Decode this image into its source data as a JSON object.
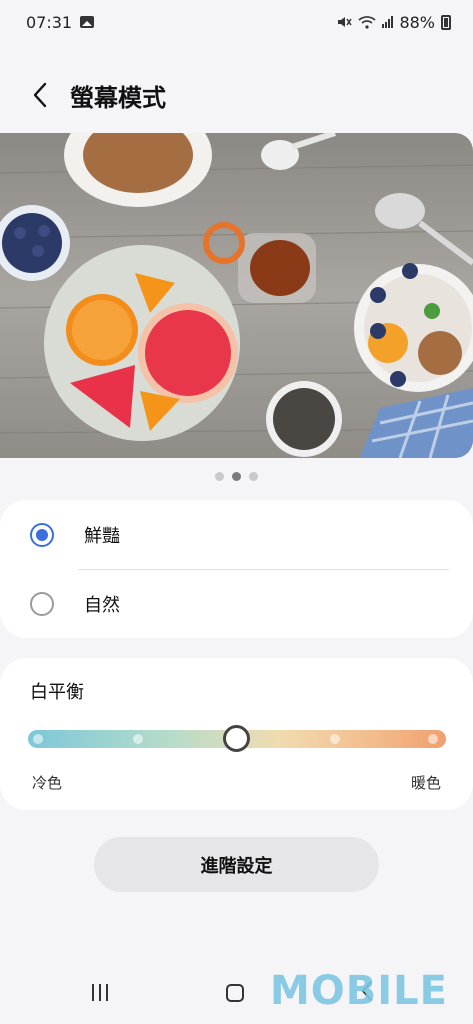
{
  "status_bar": {
    "time": "07:31",
    "battery_percent": "88%",
    "icons": [
      "gallery-icon",
      "mute-icon",
      "wifi-icon",
      "signal-icon",
      "battery-icon"
    ]
  },
  "header": {
    "title": "螢幕模式",
    "back_icon": "chevron-left-icon"
  },
  "preview": {
    "page_count": 3,
    "active_page": 2
  },
  "screen_modes": {
    "options": [
      {
        "label": "鮮豔",
        "selected": true
      },
      {
        "label": "自然",
        "selected": false
      }
    ]
  },
  "white_balance": {
    "title": "白平衡",
    "cool_label": "冷色",
    "warm_label": "暖色",
    "steps": 5,
    "value_step": 3
  },
  "advanced_button": {
    "label": "進階設定"
  },
  "watermark": {
    "text": "MOBILE"
  },
  "colors": {
    "accent": "#3a6fe0",
    "background": "#f5f5f7",
    "card": "#ffffff"
  }
}
